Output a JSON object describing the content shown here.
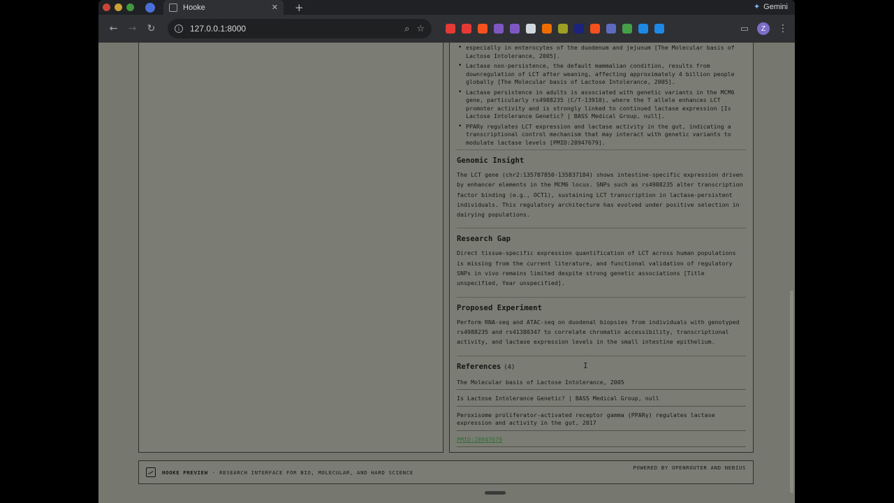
{
  "browser": {
    "tab_title": "Hooke",
    "url": "127.0.0.1:8000",
    "gemini_label": "Gemini",
    "profile_initial": "Z",
    "extension_colors": [
      "#e53935",
      "#e53935",
      "#f4511e",
      "#7e57c2",
      "#7e57c2",
      "#cfd8dc",
      "#ef6c00",
      "#9e9d24",
      "#1a237e",
      "#f4511e",
      "#5c6bc0",
      "#43a047",
      "#1e88e5",
      "#1e88e5"
    ]
  },
  "report": {
    "bullets": [
      "especially in enterocytes of the duodenum and jejunum [The Molecular basis of Lactose Intolerance, 2005].",
      "Lactase non-persistence, the default mammalian condition, results from downregulation of LCT after weaning, affecting approximately 4 billion people globally [The Molecular basis of Lactose Intolerance, 2005].",
      "Lactase persistence in adults is associated with genetic variants in the MCM6 gene, particularly rs4988235 (C/T-13910), where the T allele enhances LCT promoter activity and is strongly linked to continued lactase expression [Is Lactose Intolerance Genetic? | BASS Medical Group, null].",
      "PPARγ regulates LCT expression and lactase activity in the gut, indicating a transcriptional control mechanism that may interact with genetic variants to modulate lactase levels [PMID:28947679]."
    ],
    "genomic_insight": {
      "title": "Genomic Insight",
      "body": "The LCT gene (chr2:135787850-135837184) shows intestine-specific expression driven by enhancer elements in the MCM6 locus. SNPs such as rs4988235 alter transcription factor binding (e.g., OCT1), sustaining LCT transcription in lactase-persistent individuals. This regulatory architecture has evolved under positive selection in dairying populations."
    },
    "research_gap": {
      "title": "Research Gap",
      "body": "Direct tissue-specific expression quantification of LCT across human populations is missing from the current literature, and functional validation of regulatory SNPs in vivo remains limited despite strong genetic associations [Title unspecified, Year unspecified]."
    },
    "proposed_experiment": {
      "title": "Proposed Experiment",
      "body": "Perform RNA-seq and ATAC-seq on duodenal biopsies from individuals with genotyped rs4988235 and rs41380347 to correlate chromatin accessibility, transcriptional activity, and lactase expression levels in the small intestine epithelium."
    },
    "references": {
      "title": "References",
      "count": "(4)",
      "items": [
        "The Molecular basis of Lactose Intolerance, 2005",
        "Is Lactose Intolerance Genetic? | BASS Medical Group, null",
        "Peroxisome proliferator-activated receptor gamma (PPARγ) regulates lactase expression and activity in the gut, 2017",
        "PMID:28947679"
      ]
    }
  },
  "footer": {
    "brand": "HOOKE PREVIEW",
    "separator": "·",
    "tagline": "RESEARCH INTERFACE FOR BIO, MOLECULAR, AND HARD SCIENCE",
    "powered": "POWERED BY OPENROUTER AND NEBIUS"
  }
}
